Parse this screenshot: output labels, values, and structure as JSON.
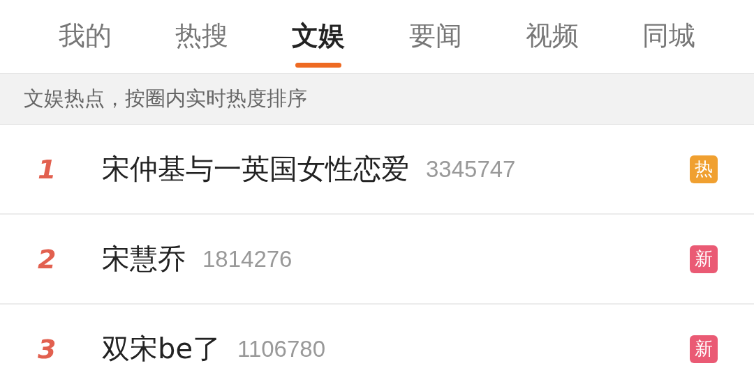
{
  "tabs": [
    {
      "label": "我的",
      "selected": false
    },
    {
      "label": "热搜",
      "selected": false
    },
    {
      "label": "文娱",
      "selected": true
    },
    {
      "label": "要闻",
      "selected": false
    },
    {
      "label": "视频",
      "selected": false
    },
    {
      "label": "同城",
      "selected": false
    }
  ],
  "notice": "文娱热点，按圈内实时热度排序",
  "items": [
    {
      "rank": "1",
      "title": "宋仲基与一英国女性恋爱",
      "count": "3345747",
      "badge": {
        "label": "热",
        "color": "#f0a030"
      }
    },
    {
      "rank": "2",
      "title": "宋慧乔",
      "count": "1814276",
      "badge": {
        "label": "新",
        "color": "#ea5a74"
      }
    },
    {
      "rank": "3",
      "title": "双宋be了",
      "count": "1106780",
      "badge": {
        "label": "新",
        "color": "#ea5a74"
      }
    }
  ]
}
